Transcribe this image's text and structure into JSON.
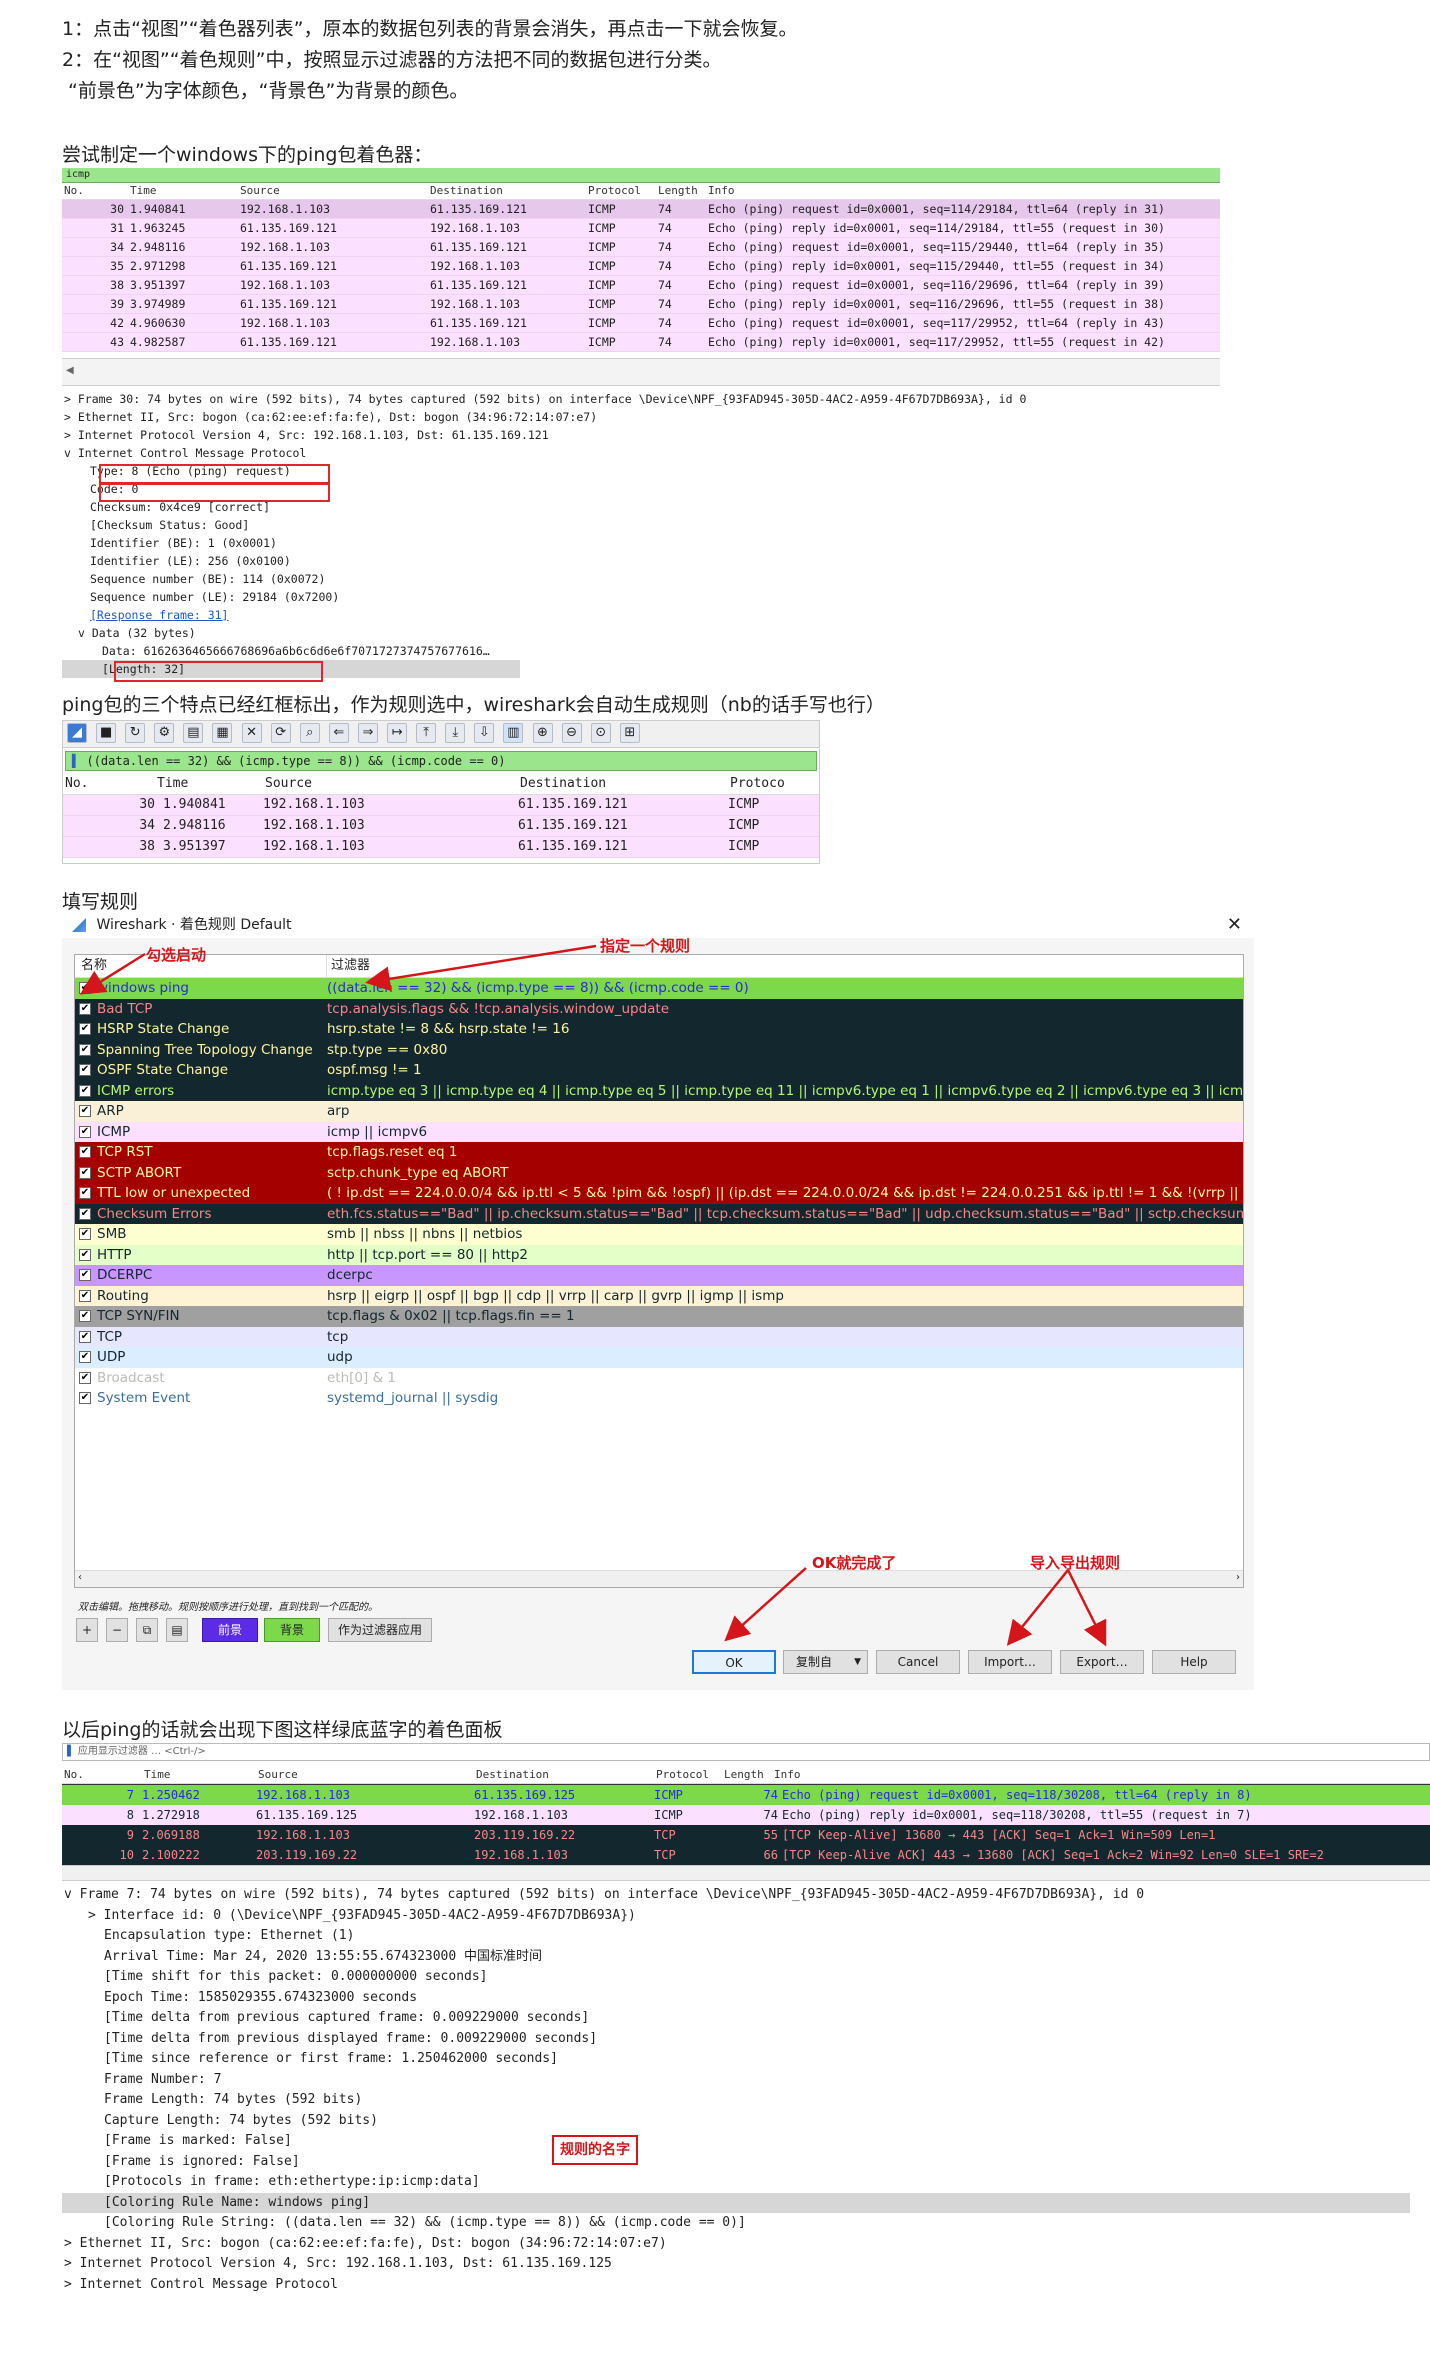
{
  "intro": {
    "line1": "1：点击“视图”“着色器列表”，原本的数据包列表的背景会消失，再点击一下就会恢复。",
    "line2": "2：在“视图”“着色规则”中，按照显示过滤器的方法把不同的数据包进行分类。",
    "line3": "“前景色”为字体颜色，“背景色”为背景的颜色。",
    "line4": "尝试制定一个windows下的ping包着色器："
  },
  "shot1": {
    "filter": "icmp",
    "headers": [
      "No.",
      "Time",
      "Source",
      "Destination",
      "Protocol",
      "Length",
      "Info"
    ],
    "rows": [
      [
        "30",
        "1.940841",
        "192.168.1.103",
        "61.135.169.121",
        "ICMP",
        "74",
        "Echo (ping) request  id=0x0001, seq=114/29184, ttl=64 (reply in 31)"
      ],
      [
        "31",
        "1.963245",
        "61.135.169.121",
        "192.168.1.103",
        "ICMP",
        "74",
        "Echo (ping) reply    id=0x0001, seq=114/29184, ttl=55 (request in 30)"
      ],
      [
        "34",
        "2.948116",
        "192.168.1.103",
        "61.135.169.121",
        "ICMP",
        "74",
        "Echo (ping) request  id=0x0001, seq=115/29440, ttl=64 (reply in 35)"
      ],
      [
        "35",
        "2.971298",
        "61.135.169.121",
        "192.168.1.103",
        "ICMP",
        "74",
        "Echo (ping) reply    id=0x0001, seq=115/29440, ttl=55 (request in 34)"
      ],
      [
        "38",
        "3.951397",
        "192.168.1.103",
        "61.135.169.121",
        "ICMP",
        "74",
        "Echo (ping) request  id=0x0001, seq=116/29696, ttl=64 (reply in 39)"
      ],
      [
        "39",
        "3.974989",
        "61.135.169.121",
        "192.168.1.103",
        "ICMP",
        "74",
        "Echo (ping) reply    id=0x0001, seq=116/29696, ttl=55 (request in 38)"
      ],
      [
        "42",
        "4.960630",
        "192.168.1.103",
        "61.135.169.121",
        "ICMP",
        "74",
        "Echo (ping) request  id=0x0001, seq=117/29952, ttl=64 (reply in 43)"
      ],
      [
        "43",
        "4.982587",
        "61.135.169.121",
        "192.168.1.103",
        "ICMP",
        "74",
        "Echo (ping) reply    id=0x0001, seq=117/29952, ttl=55 (request in 42)"
      ]
    ],
    "details": [
      "> Frame 30: 74 bytes on wire (592 bits), 74 bytes captured (592 bits) on interface \\Device\\NPF_{93FAD945-305D-4AC2-A959-4F67D7DB693A}, id 0",
      "> Ethernet II, Src: bogon (ca:62:ee:ef:fa:fe), Dst: bogon (34:96:72:14:07:e7)",
      "> Internet Protocol Version 4, Src: 192.168.1.103, Dst: 61.135.169.121",
      "v Internet Control Message Protocol",
      "Type: 8 (Echo (ping) request)",
      "Code: 0",
      "Checksum: 0x4ce9 [correct]",
      "[Checksum Status: Good]",
      "Identifier (BE): 1 (0x0001)",
      "Identifier (LE): 256 (0x0100)",
      "Sequence number (BE): 114 (0x0072)",
      "Sequence number (LE): 29184 (0x7200)",
      "[Response frame: 31]",
      "v Data (32 bytes)",
      "Data: 6162636465666768696a6b6c6d6e6f7071727374757677616…",
      "[Length: 32]"
    ]
  },
  "text2": "ping包的三个特点已经红框标出，作为规则选中，wireshark会自动生成规则（nb的话手写也行）",
  "shot2": {
    "filter": "((data.len == 32) && (icmp.type == 8)) && (icmp.code == 0)",
    "headers": [
      "No.",
      "Time",
      "Source",
      "Destination",
      "Protoco"
    ],
    "rows": [
      [
        "30",
        "1.940841",
        "192.168.1.103",
        "61.135.169.121",
        "ICMP"
      ],
      [
        "34",
        "2.948116",
        "192.168.1.103",
        "61.135.169.121",
        "ICMP"
      ],
      [
        "38",
        "3.951397",
        "192.168.1.103",
        "61.135.169.121",
        "ICMP"
      ]
    ]
  },
  "text3": "填写规则",
  "dialog": {
    "title": "Wireshark · 着色规则 Default",
    "col_name": "名称",
    "col_filter": "过滤器",
    "rules": [
      {
        "name": "windows ping",
        "filter": "((data.len == 32) && (icmp.type == 8)) && (icmp.code == 0)",
        "bg": "#7bd94a",
        "fg": "#2a2ad8"
      },
      {
        "name": "Bad TCP",
        "filter": "tcp.analysis.flags && !tcp.analysis.window_update",
        "bg": "#12272e",
        "fg": "#f78787"
      },
      {
        "name": "HSRP State Change",
        "filter": "hsrp.state != 8 && hsrp.state != 16",
        "bg": "#12272e",
        "fg": "#fff5a0"
      },
      {
        "name": "Spanning Tree Topology  Change",
        "filter": "stp.type == 0x80",
        "bg": "#12272e",
        "fg": "#fff5a0"
      },
      {
        "name": "OSPF State Change",
        "filter": "ospf.msg != 1",
        "bg": "#12272e",
        "fg": "#fff5a0"
      },
      {
        "name": "ICMP errors",
        "filter": "icmp.type eq 3 || icmp.type eq 4 || icmp.type eq 5 || icmp.type eq 11 || icmpv6.type eq 1 || icmpv6.type eq 2 || icmpv6.type eq 3 || icmpv",
        "bg": "#12272e",
        "fg": "#b7f774"
      },
      {
        "name": "ARP",
        "filter": "arp",
        "bg": "#faf0d7",
        "fg": "#12272e"
      },
      {
        "name": "ICMP",
        "filter": "icmp || icmpv6",
        "bg": "#fce0ff",
        "fg": "#12272e"
      },
      {
        "name": "TCP RST",
        "filter": "tcp.flags.reset eq 1",
        "bg": "#a40000",
        "fg": "#fffc9c"
      },
      {
        "name": "SCTP ABORT",
        "filter": "sctp.chunk_type eq ABORT",
        "bg": "#a40000",
        "fg": "#fffc9c"
      },
      {
        "name": "TTL low or unexpected",
        "filter": "( ! ip.dst == 224.0.0.0/4 && ip.ttl < 5 && !pim && !ospf) || (ip.dst == 224.0.0.0/24 && ip.dst != 224.0.0.251 && ip.ttl != 1 && !(vrrp || ca",
        "bg": "#a40000",
        "fg": "#fffc9c"
      },
      {
        "name": "Checksum Errors",
        "filter": "eth.fcs.status==\"Bad\" || ip.checksum.status==\"Bad\" || tcp.checksum.status==\"Bad\" || udp.checksum.status==\"Bad\" || sctp.checksum.sta",
        "bg": "#12272e",
        "fg": "#f78787"
      },
      {
        "name": "SMB",
        "filter": "smb || nbss || nbns || netbios",
        "bg": "#feffd0",
        "fg": "#12272e"
      },
      {
        "name": "HTTP",
        "filter": "http || tcp.port == 80 || http2",
        "bg": "#e4ffc7",
        "fg": "#12272e"
      },
      {
        "name": "DCERPC",
        "filter": "dcerpc",
        "bg": "#c797ff",
        "fg": "#12272e"
      },
      {
        "name": "Routing",
        "filter": "hsrp || eigrp || ospf || bgp || cdp || vrrp || carp || gvrp || igmp || ismp",
        "bg": "#fff3d6",
        "fg": "#12272e"
      },
      {
        "name": "TCP SYN/FIN",
        "filter": "tcp.flags & 0x02 || tcp.flags.fin == 1",
        "bg": "#a0a0a0",
        "fg": "#12272e"
      },
      {
        "name": "TCP",
        "filter": "tcp",
        "bg": "#e7e6ff",
        "fg": "#12272e"
      },
      {
        "name": "UDP",
        "filter": "udp",
        "bg": "#daeeff",
        "fg": "#12272e"
      },
      {
        "name": "Broadcast",
        "filter": "eth[0] & 1",
        "bg": "#ffffff",
        "fg": "#babdb6"
      },
      {
        "name": "System Event",
        "filter": "systemd_journal || sysdig",
        "bg": "#ffffff",
        "fg": "#3c6e9a"
      }
    ],
    "hint": "双击编辑。拖拽移动。规则按顺序进行处理，直到找到一个匹配的。",
    "fg_label": "前景",
    "bg_label": "背景",
    "apply_label": "作为过滤器应用",
    "ok": "OK",
    "copy_from": "复制自",
    "cancel": "Cancel",
    "import": "Import…",
    "export": "Export…",
    "help": "Help",
    "annotations": {
      "check": "勾选启动",
      "specify": "指定一个规则",
      "ok_done": "OK就完成了",
      "import_export": "导入导出规则"
    }
  },
  "text4": "以后ping的话就会出现下图这样绿底蓝字的着色面板",
  "shot3": {
    "filter_placeholder": "应用显示过滤器 … <Ctrl-/>",
    "headers": [
      "No.",
      "Time",
      "Source",
      "Destination",
      "Protocol",
      "Length",
      "Info"
    ],
    "rows": [
      [
        "7",
        "1.250462",
        "192.168.1.103",
        "61.135.169.125",
        "ICMP",
        "74",
        "Echo (ping) request  id=0x0001, seq=118/30208, ttl=64 (reply in 8)"
      ],
      [
        "8",
        "1.272918",
        "61.135.169.125",
        "192.168.1.103",
        "ICMP",
        "74",
        "Echo (ping) reply    id=0x0001, seq=118/30208, ttl=55 (request in 7)"
      ],
      [
        "9",
        "2.069188",
        "192.168.1.103",
        "203.119.169.22",
        "TCP",
        "55",
        "[TCP Keep-Alive] 13680 → 443 [ACK] Seq=1 Ack=1 Win=509 Len=1"
      ],
      [
        "10",
        "2.100222",
        "203.119.169.22",
        "192.168.1.103",
        "TCP",
        "66",
        "[TCP Keep-Alive ACK] 443 → 13680 [ACK] Seq=1 Ack=2 Win=92 Len=0 SLE=1 SRE=2"
      ]
    ],
    "details": [
      "v Frame 7: 74 bytes on wire (592 bits), 74 bytes captured (592 bits) on interface \\Device\\NPF_{93FAD945-305D-4AC2-A959-4F67D7DB693A}, id 0",
      "> Interface id: 0 (\\Device\\NPF_{93FAD945-305D-4AC2-A959-4F67D7DB693A})",
      "Encapsulation type: Ethernet (1)",
      "Arrival Time: Mar 24, 2020 13:55:55.674323000 中国标准时间",
      "[Time shift for this packet: 0.000000000 seconds]",
      "Epoch Time: 1585029355.674323000 seconds",
      "[Time delta from previous captured frame: 0.009229000 seconds]",
      "[Time delta from previous displayed frame: 0.009229000 seconds]",
      "[Time since reference or first frame: 1.250462000 seconds]",
      "Frame Number: 7",
      "Frame Length: 74 bytes (592 bits)",
      "Capture Length: 74 bytes (592 bits)",
      "[Frame is marked: False]",
      "[Frame is ignored: False]",
      "[Protocols in frame: eth:ethertype:ip:icmp:data]",
      "[Coloring Rule Name: windows ping]",
      "[Coloring Rule String: ((data.len == 32) && (icmp.type == 8)) && (icmp.code == 0)]",
      "> Ethernet II, Src: bogon (ca:62:ee:ef:fa:fe), Dst: bogon (34:96:72:14:07:e7)",
      "> Internet Protocol Version 4, Src: 192.168.1.103, Dst: 61.135.169.125",
      "> Internet Control Message Protocol"
    ],
    "annotation": "规则的名字"
  },
  "colors": {
    "accent_red": "#e0262a",
    "pink_row": "#fce0ff",
    "green_row": "#7bd94a",
    "dark_row": "#12272e",
    "filter_green": "#9be58c"
  }
}
